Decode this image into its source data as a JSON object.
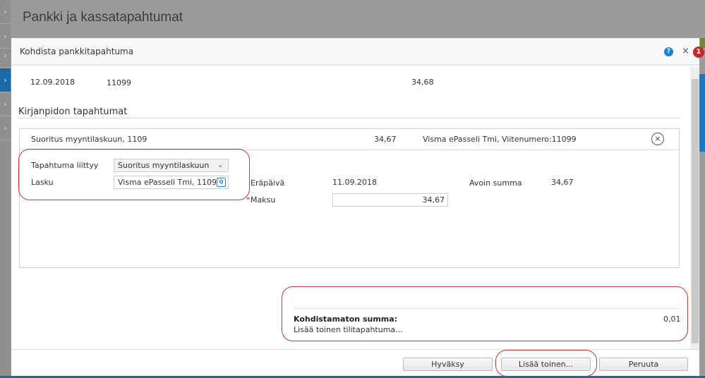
{
  "page": {
    "title": "Pankki ja kassatapahtumat",
    "notification_count": "1"
  },
  "dialog": {
    "title": "Kohdista pankkitapahtuma",
    "help_label": "?",
    "close_label": "×",
    "bank_row": {
      "date": "12.09.2018",
      "reference": "11099",
      "amount": "34,68"
    },
    "section_title": "Kirjanpidon tapahtumat",
    "entry": {
      "title": "Suoritus myyntilaskuun, 1109",
      "amount": "34,67",
      "description": "Visma ePasseli Tmi, Viitenumero:11099",
      "remove_label": "×",
      "type_label": "Tapahtuma liittyy",
      "type_value": "Suoritus myyntilaskuun",
      "invoice_label": "Lasku",
      "invoice_value": "Visma ePasseli Tmi, 1109",
      "due_label": "Eräpäivä",
      "due_value": "11.09.2018",
      "open_label": "Avoin summa",
      "open_value": "34,67",
      "payment_required": "*",
      "payment_label": "Maksu",
      "payment_value": "34,67"
    },
    "summary": {
      "unallocated_label": "Kohdistamaton summa:",
      "unallocated_value": "0,01",
      "add_link": "Lisää toinen tilitapahtuma..."
    },
    "buttons": {
      "accept": "Hyväksy",
      "add_another": "Lisää toinen...",
      "cancel": "Peruuta"
    }
  },
  "colors": {
    "accent": "#1b76c0",
    "annotation": "#c0392b",
    "badge": "#c9252c"
  }
}
